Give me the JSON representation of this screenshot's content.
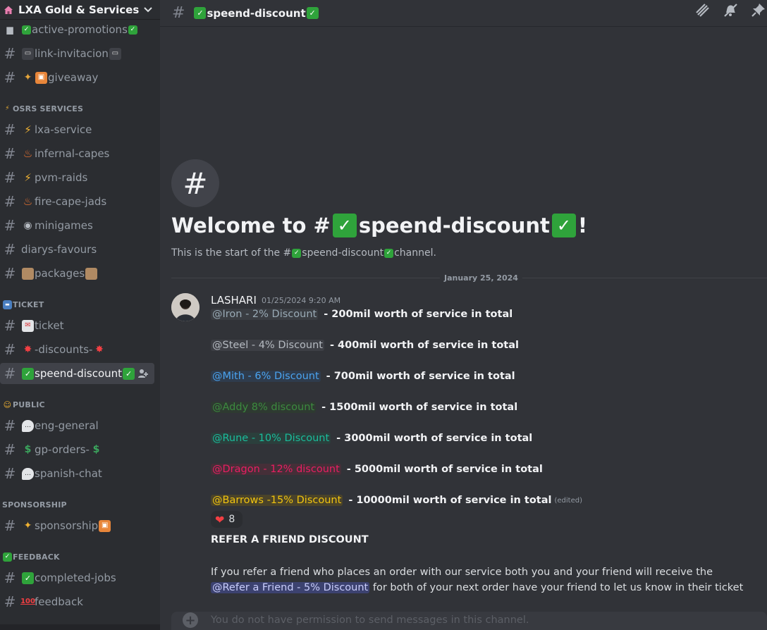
{
  "server": {
    "name": "LXA Gold & Services",
    "icon": "house-icon",
    "chevron": "chevron-down-icon"
  },
  "sidebar": {
    "channels_top": [
      {
        "label": "active-promotions",
        "pre": "truck",
        "post": "check"
      },
      {
        "label": "link-invitacion",
        "pre": "laptop",
        "post": "laptop"
      },
      {
        "label": "giveaway",
        "pre": "party+gift",
        "post": ""
      }
    ],
    "categories": {
      "osrs": "OSRS SERVICES",
      "ticket": "TICKET",
      "public": "PUBLIC",
      "sponsorship": "SPONSORSHIP",
      "feedback": "FEEDBACK"
    },
    "osrs_channels": [
      "lxa-service",
      "infernal-capes",
      "pvm-raids",
      "fire-cape-jads",
      "minigames",
      "diarys-favours",
      "packages"
    ],
    "ticket_channels": [
      "ticket",
      "-discounts-",
      "speend-discount"
    ],
    "public_channels": [
      "eng-general",
      "gp-orders-",
      "spanish-chat"
    ],
    "sponsorship_channels": [
      "sponsorship"
    ],
    "feedback_channels": [
      "completed-jobs",
      "feedback"
    ]
  },
  "topbar": {
    "hash": "#",
    "channel_name": "speend-discount",
    "icons": [
      "threads-icon",
      "mute-bell-icon",
      "pin-icon"
    ]
  },
  "welcome": {
    "hash": "#",
    "title_prefix": "Welcome to #",
    "title_channel": "speend-discount",
    "title_suffix": "!",
    "sub_prefix": "This is the start of the #",
    "sub_channel": "speend-discount",
    "sub_suffix": " channel."
  },
  "divider_date": "January 25, 2024",
  "message": {
    "author": "LASHARI",
    "timestamp": "01/25/2024 9:20 AM",
    "tiers": [
      {
        "role": "@Iron - 2% Discount",
        "text": "- 200mil worth of service in total",
        "color": "#99aab5",
        "bg": "#3a3d42"
      },
      {
        "role": "@Steel - 4% Discount",
        "text": "- 400mil worth of service in total",
        "color": "#b5bac1",
        "bg": "#3d3f45"
      },
      {
        "role": "@Mith - 6% Discount",
        "text": "- 700mil worth of service in total",
        "color": "#4aa3f0",
        "bg": "#2f3c4d"
      },
      {
        "role": "@Addy 8% discount",
        "text": "- 1500mil worth of service in total",
        "color": "#3c8a3f",
        "bg": "#2e3a31"
      },
      {
        "role": "@Rune - 10% Discount",
        "text": "- 3000mil worth of service in total",
        "color": "#1abc9c",
        "bg": "#2b3f3c"
      },
      {
        "role": "@Dragon - 12% discount",
        "text": "- 5000mil worth of service in total",
        "color": "#e91e63",
        "bg": "#452f38"
      },
      {
        "role": "@Barrows -15% Discount",
        "text": "- 10000mil worth of service in total",
        "color": "#f1c40f",
        "bg": "#4a432a"
      }
    ],
    "edited": "(edited)",
    "reaction": {
      "emoji": "heart-icon",
      "count": "8"
    },
    "refer_title": "REFER A FRIEND DISCOUNT",
    "refer_before": "If you refer a friend who places an order with our service both you and your friend will receive the ",
    "refer_mention": "@Refer a Friend - 5% Discount",
    "refer_after": "  for both of your next order have your friend to let us know in their ticket"
  },
  "input": {
    "placeholder": "You do not have permission to send messages in this channel."
  }
}
